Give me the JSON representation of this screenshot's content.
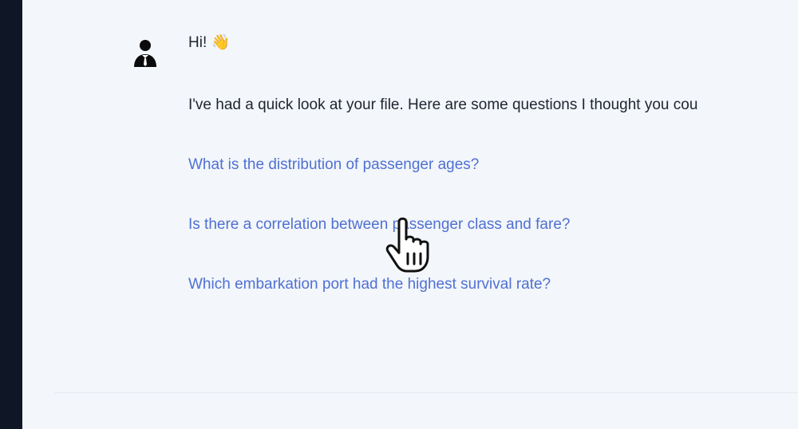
{
  "chat": {
    "greeting": "Hi! 👋",
    "intro": "I've had a quick look at your file. Here are some questions I thought you cou",
    "suggested_questions": [
      {
        "label": "What is the distribution of passenger ages?"
      },
      {
        "label": "Is there a correlation between passenger class and fare?"
      },
      {
        "label": "Which embarkation port had the highest survival rate?"
      }
    ]
  },
  "colors": {
    "sidebar": "#0f1726",
    "background": "#f3f6fa",
    "link": "#4f70d3",
    "text": "#1f2430"
  },
  "icons": {
    "avatar": "user-with-tie-icon",
    "cursor": "hand-pointer-cursor-icon"
  }
}
